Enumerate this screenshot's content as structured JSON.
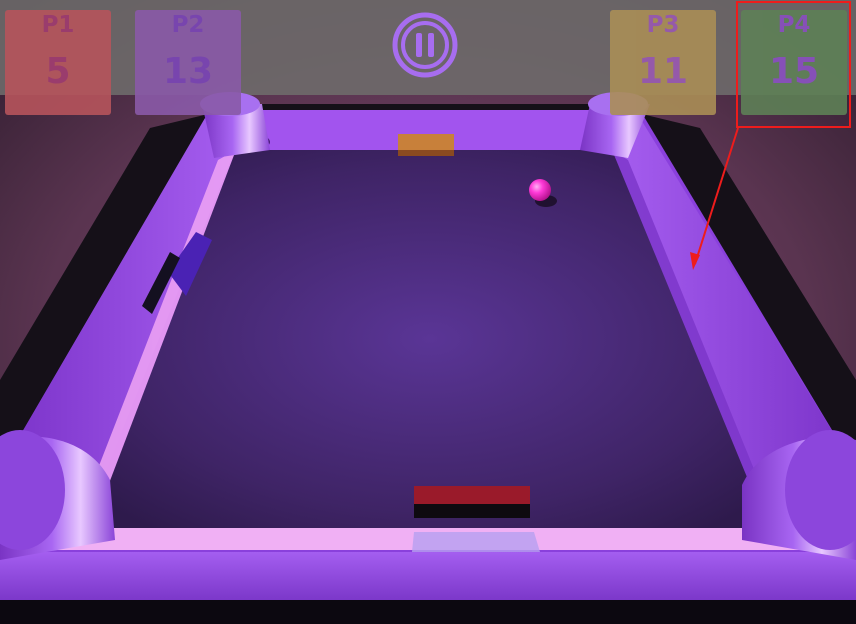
{
  "scoreboard": [
    {
      "id": "p1",
      "label": "P1",
      "score": "5",
      "card_color": "#b6545c",
      "text_color": "#a0386e"
    },
    {
      "id": "p2",
      "label": "P2",
      "score": "13",
      "card_color": "#8a5aa8",
      "text_color": "#7a42b6"
    },
    {
      "id": "p3",
      "label": "P3",
      "score": "11",
      "card_color": "#aa8e56",
      "text_color": "#9a58b2"
    },
    {
      "id": "p4",
      "label": "P4",
      "score": "15",
      "card_color": "#5e8056",
      "text_color": "#8a4fc0"
    }
  ],
  "pause_button": {
    "icon": "pause-icon",
    "color": "#a76df0"
  },
  "annotation": {
    "target": "p4",
    "color": "#ee1c1c"
  },
  "colors": {
    "rail": "#9a4ee8",
    "rail_dark": "#6a2cb0",
    "rail_glow": "#f2a8f4",
    "field": "#4a2a7c",
    "ball": "#ff3ad8",
    "paddle_top": "#c8803a",
    "paddle_left": "#4a22b4",
    "paddle_bottom": "#9a1a2a"
  }
}
